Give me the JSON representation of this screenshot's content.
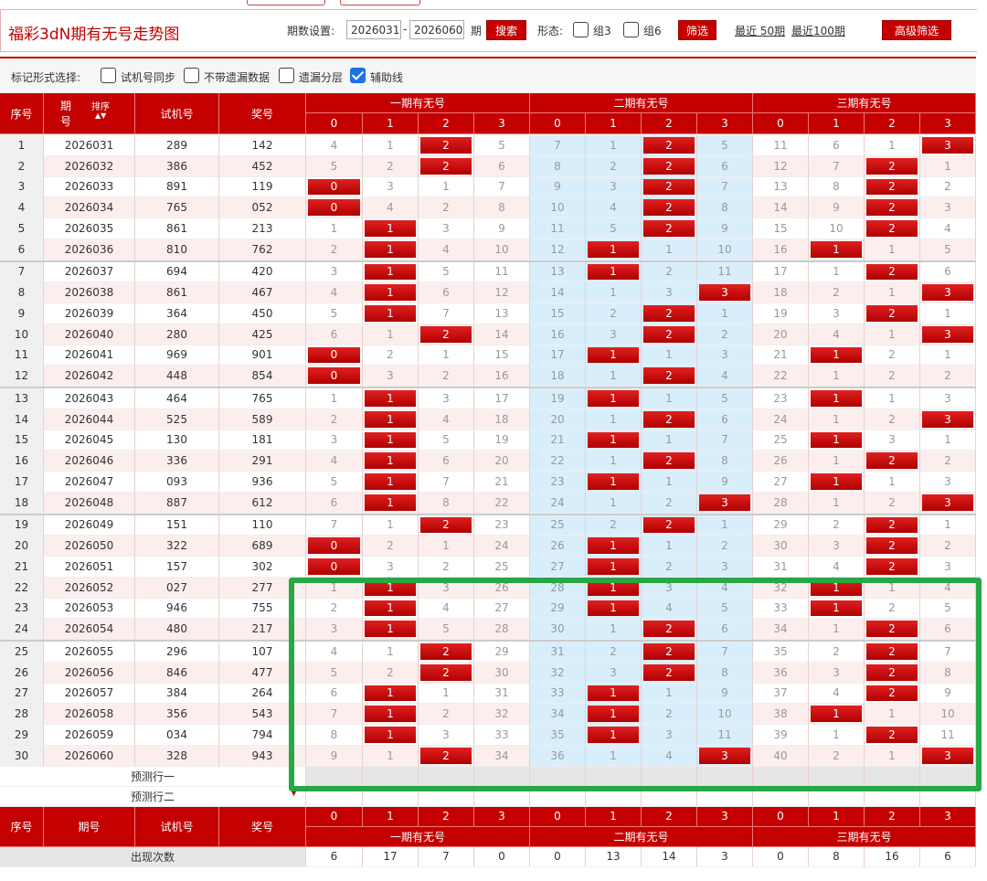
{
  "header": {
    "title": "福彩3dN期有无号走势图",
    "period_label": "期数设置:",
    "period_from": "2026031",
    "period_to": "2026060",
    "dash": "-",
    "period_unit": "期",
    "search_btn": "搜索",
    "form_label": "形态:",
    "group3": "组3",
    "group6": "组6",
    "filter_btn": "筛选",
    "recent50": "最近 50期",
    "recent100": "最近100期",
    "advanced_btn": "高级筛选"
  },
  "mark_bar": {
    "label": "标记形式选择:",
    "options": [
      {
        "label": "试机号同步",
        "checked": false
      },
      {
        "label": "不带遗漏数据",
        "checked": false
      },
      {
        "label": "遗漏分层",
        "checked": false
      },
      {
        "label": "辅助线",
        "checked": true
      }
    ]
  },
  "table": {
    "col_index": "序号",
    "col_issue_a": "期",
    "col_issue_b": "号",
    "col_sort": "排序",
    "col_trial": "试机号",
    "col_award": "奖号",
    "groups": [
      "一期有无号",
      "二期有无号",
      "三期有无号"
    ],
    "digits": [
      "0",
      "1",
      "2",
      "3"
    ],
    "rows": [
      {
        "i": "1",
        "issue": "2026031",
        "trial": "289",
        "award": "142",
        "g": [
          [
            "4",
            "1",
            "2",
            "5"
          ],
          [
            "7",
            "1",
            "2",
            "5"
          ],
          [
            "11",
            "6",
            "1",
            "3"
          ]
        ],
        "h": [
          2,
          2,
          3
        ]
      },
      {
        "i": "2",
        "issue": "2026032",
        "trial": "386",
        "award": "452",
        "g": [
          [
            "5",
            "2",
            "2",
            "6"
          ],
          [
            "8",
            "2",
            "2",
            "6"
          ],
          [
            "12",
            "7",
            "2",
            "1"
          ]
        ],
        "h": [
          2,
          2,
          2
        ]
      },
      {
        "i": "3",
        "issue": "2026033",
        "trial": "891",
        "award": "119",
        "g": [
          [
            "0",
            "3",
            "1",
            "7"
          ],
          [
            "9",
            "3",
            "2",
            "7"
          ],
          [
            "13",
            "8",
            "2",
            "2"
          ]
        ],
        "h": [
          0,
          2,
          2
        ]
      },
      {
        "i": "4",
        "issue": "2026034",
        "trial": "765",
        "award": "052",
        "g": [
          [
            "0",
            "4",
            "2",
            "8"
          ],
          [
            "10",
            "4",
            "2",
            "8"
          ],
          [
            "14",
            "9",
            "2",
            "3"
          ]
        ],
        "h": [
          0,
          2,
          2
        ]
      },
      {
        "i": "5",
        "issue": "2026035",
        "trial": "861",
        "award": "213",
        "g": [
          [
            "1",
            "1",
            "3",
            "9"
          ],
          [
            "11",
            "5",
            "2",
            "9"
          ],
          [
            "15",
            "10",
            "2",
            "4"
          ]
        ],
        "h": [
          1,
          2,
          2
        ]
      },
      {
        "i": "6",
        "issue": "2026036",
        "trial": "810",
        "award": "762",
        "g": [
          [
            "2",
            "1",
            "4",
            "10"
          ],
          [
            "12",
            "1",
            "1",
            "10"
          ],
          [
            "16",
            "1",
            "1",
            "5"
          ]
        ],
        "h": [
          1,
          1,
          1
        ]
      },
      {
        "i": "7",
        "issue": "2026037",
        "trial": "694",
        "award": "420",
        "g": [
          [
            "3",
            "1",
            "5",
            "11"
          ],
          [
            "13",
            "1",
            "2",
            "11"
          ],
          [
            "17",
            "1",
            "2",
            "6"
          ]
        ],
        "h": [
          1,
          1,
          2
        ]
      },
      {
        "i": "8",
        "issue": "2026038",
        "trial": "861",
        "award": "467",
        "g": [
          [
            "4",
            "1",
            "6",
            "12"
          ],
          [
            "14",
            "1",
            "3",
            "3"
          ],
          [
            "18",
            "2",
            "1",
            "3"
          ]
        ],
        "h": [
          1,
          3,
          3
        ]
      },
      {
        "i": "9",
        "issue": "2026039",
        "trial": "364",
        "award": "450",
        "g": [
          [
            "5",
            "1",
            "7",
            "13"
          ],
          [
            "15",
            "2",
            "2",
            "1"
          ],
          [
            "19",
            "3",
            "2",
            "1"
          ]
        ],
        "h": [
          1,
          2,
          2
        ]
      },
      {
        "i": "10",
        "issue": "2026040",
        "trial": "280",
        "award": "425",
        "g": [
          [
            "6",
            "1",
            "2",
            "14"
          ],
          [
            "16",
            "3",
            "2",
            "2"
          ],
          [
            "20",
            "4",
            "1",
            "3"
          ]
        ],
        "h": [
          2,
          2,
          3
        ]
      },
      {
        "i": "11",
        "issue": "2026041",
        "trial": "969",
        "award": "901",
        "g": [
          [
            "0",
            "2",
            "1",
            "15"
          ],
          [
            "17",
            "1",
            "1",
            "3"
          ],
          [
            "21",
            "1",
            "2",
            "1"
          ]
        ],
        "h": [
          0,
          1,
          1
        ]
      },
      {
        "i": "12",
        "issue": "2026042",
        "trial": "448",
        "award": "854",
        "g": [
          [
            "0",
            "3",
            "2",
            "16"
          ],
          [
            "18",
            "1",
            "2",
            "4"
          ],
          [
            "22",
            "1",
            "2",
            "2"
          ]
        ],
        "h": [
          0,
          2,
          -1
        ]
      },
      {
        "i": "13",
        "issue": "2026043",
        "trial": "464",
        "award": "765",
        "g": [
          [
            "1",
            "1",
            "3",
            "17"
          ],
          [
            "19",
            "1",
            "1",
            "5"
          ],
          [
            "23",
            "1",
            "1",
            "3"
          ]
        ],
        "h": [
          1,
          1,
          1
        ]
      },
      {
        "i": "14",
        "issue": "2026044",
        "trial": "525",
        "award": "589",
        "g": [
          [
            "2",
            "1",
            "4",
            "18"
          ],
          [
            "20",
            "1",
            "2",
            "6"
          ],
          [
            "24",
            "1",
            "2",
            "3"
          ]
        ],
        "h": [
          1,
          2,
          3
        ]
      },
      {
        "i": "15",
        "issue": "2026045",
        "trial": "130",
        "award": "181",
        "g": [
          [
            "3",
            "1",
            "5",
            "19"
          ],
          [
            "21",
            "1",
            "1",
            "7"
          ],
          [
            "25",
            "1",
            "3",
            "1"
          ]
        ],
        "h": [
          1,
          1,
          1
        ]
      },
      {
        "i": "16",
        "issue": "2026046",
        "trial": "336",
        "award": "291",
        "g": [
          [
            "4",
            "1",
            "6",
            "20"
          ],
          [
            "22",
            "1",
            "2",
            "8"
          ],
          [
            "26",
            "1",
            "2",
            "2"
          ]
        ],
        "h": [
          1,
          2,
          2
        ]
      },
      {
        "i": "17",
        "issue": "2026047",
        "trial": "093",
        "award": "936",
        "g": [
          [
            "5",
            "1",
            "7",
            "21"
          ],
          [
            "23",
            "1",
            "1",
            "9"
          ],
          [
            "27",
            "1",
            "1",
            "3"
          ]
        ],
        "h": [
          1,
          1,
          1
        ]
      },
      {
        "i": "18",
        "issue": "2026048",
        "trial": "887",
        "award": "612",
        "g": [
          [
            "6",
            "1",
            "8",
            "22"
          ],
          [
            "24",
            "1",
            "2",
            "3"
          ],
          [
            "28",
            "1",
            "2",
            "3"
          ]
        ],
        "h": [
          1,
          3,
          3
        ]
      },
      {
        "i": "19",
        "issue": "2026049",
        "trial": "151",
        "award": "110",
        "g": [
          [
            "7",
            "1",
            "2",
            "23"
          ],
          [
            "25",
            "2",
            "2",
            "1"
          ],
          [
            "29",
            "2",
            "2",
            "1"
          ]
        ],
        "h": [
          2,
          2,
          2
        ]
      },
      {
        "i": "20",
        "issue": "2026050",
        "trial": "322",
        "award": "689",
        "g": [
          [
            "0",
            "2",
            "1",
            "24"
          ],
          [
            "26",
            "1",
            "1",
            "2"
          ],
          [
            "30",
            "3",
            "2",
            "2"
          ]
        ],
        "h": [
          0,
          1,
          2
        ]
      },
      {
        "i": "21",
        "issue": "2026051",
        "trial": "157",
        "award": "302",
        "g": [
          [
            "0",
            "3",
            "2",
            "25"
          ],
          [
            "27",
            "1",
            "2",
            "3"
          ],
          [
            "31",
            "4",
            "2",
            "3"
          ]
        ],
        "h": [
          0,
          1,
          2
        ]
      },
      {
        "i": "22",
        "issue": "2026052",
        "trial": "027",
        "award": "277",
        "g": [
          [
            "1",
            "1",
            "3",
            "26"
          ],
          [
            "28",
            "1",
            "3",
            "4"
          ],
          [
            "32",
            "1",
            "1",
            "4"
          ]
        ],
        "h": [
          1,
          1,
          1
        ]
      },
      {
        "i": "23",
        "issue": "2026053",
        "trial": "946",
        "award": "755",
        "g": [
          [
            "2",
            "1",
            "4",
            "27"
          ],
          [
            "29",
            "1",
            "4",
            "5"
          ],
          [
            "33",
            "1",
            "2",
            "5"
          ]
        ],
        "h": [
          1,
          1,
          1
        ]
      },
      {
        "i": "24",
        "issue": "2026054",
        "trial": "480",
        "award": "217",
        "g": [
          [
            "3",
            "1",
            "5",
            "28"
          ],
          [
            "30",
            "1",
            "2",
            "6"
          ],
          [
            "34",
            "1",
            "2",
            "6"
          ]
        ],
        "h": [
          1,
          2,
          2
        ]
      },
      {
        "i": "25",
        "issue": "2026055",
        "trial": "296",
        "award": "107",
        "g": [
          [
            "4",
            "1",
            "2",
            "29"
          ],
          [
            "31",
            "2",
            "2",
            "7"
          ],
          [
            "35",
            "2",
            "2",
            "7"
          ]
        ],
        "h": [
          2,
          2,
          2
        ]
      },
      {
        "i": "26",
        "issue": "2026056",
        "trial": "846",
        "award": "477",
        "g": [
          [
            "5",
            "2",
            "2",
            "30"
          ],
          [
            "32",
            "3",
            "2",
            "8"
          ],
          [
            "36",
            "3",
            "2",
            "8"
          ]
        ],
        "h": [
          2,
          2,
          2
        ]
      },
      {
        "i": "27",
        "issue": "2026057",
        "trial": "384",
        "award": "264",
        "g": [
          [
            "6",
            "1",
            "1",
            "31"
          ],
          [
            "33",
            "1",
            "1",
            "9"
          ],
          [
            "37",
            "4",
            "2",
            "9"
          ]
        ],
        "h": [
          1,
          1,
          2
        ]
      },
      {
        "i": "28",
        "issue": "2026058",
        "trial": "356",
        "award": "543",
        "g": [
          [
            "7",
            "1",
            "2",
            "32"
          ],
          [
            "34",
            "1",
            "2",
            "10"
          ],
          [
            "38",
            "1",
            "1",
            "10"
          ]
        ],
        "h": [
          1,
          1,
          1
        ]
      },
      {
        "i": "29",
        "issue": "2026059",
        "trial": "034",
        "award": "794",
        "g": [
          [
            "8",
            "1",
            "3",
            "33"
          ],
          [
            "35",
            "1",
            "3",
            "11"
          ],
          [
            "39",
            "1",
            "2",
            "11"
          ]
        ],
        "h": [
          1,
          1,
          2
        ]
      },
      {
        "i": "30",
        "issue": "2026060",
        "trial": "328",
        "award": "943",
        "g": [
          [
            "9",
            "1",
            "2",
            "34"
          ],
          [
            "36",
            "1",
            "4",
            "3"
          ],
          [
            "40",
            "2",
            "1",
            "3"
          ]
        ],
        "h": [
          2,
          3,
          3
        ]
      }
    ],
    "predict1": "预测行一",
    "predict2": "预测行二",
    "footer_issue": "期号",
    "occurrence_label": "出现次数",
    "occurrence": [
      [
        "6",
        "17",
        "7",
        "0"
      ],
      [
        "0",
        "13",
        "14",
        "3"
      ],
      [
        "0",
        "8",
        "16",
        "6"
      ]
    ]
  },
  "colors": {
    "red": "#c40000",
    "blue_zone": "#d9eefb",
    "pink_row": "#fdeeee",
    "green_box": "#28a745"
  }
}
